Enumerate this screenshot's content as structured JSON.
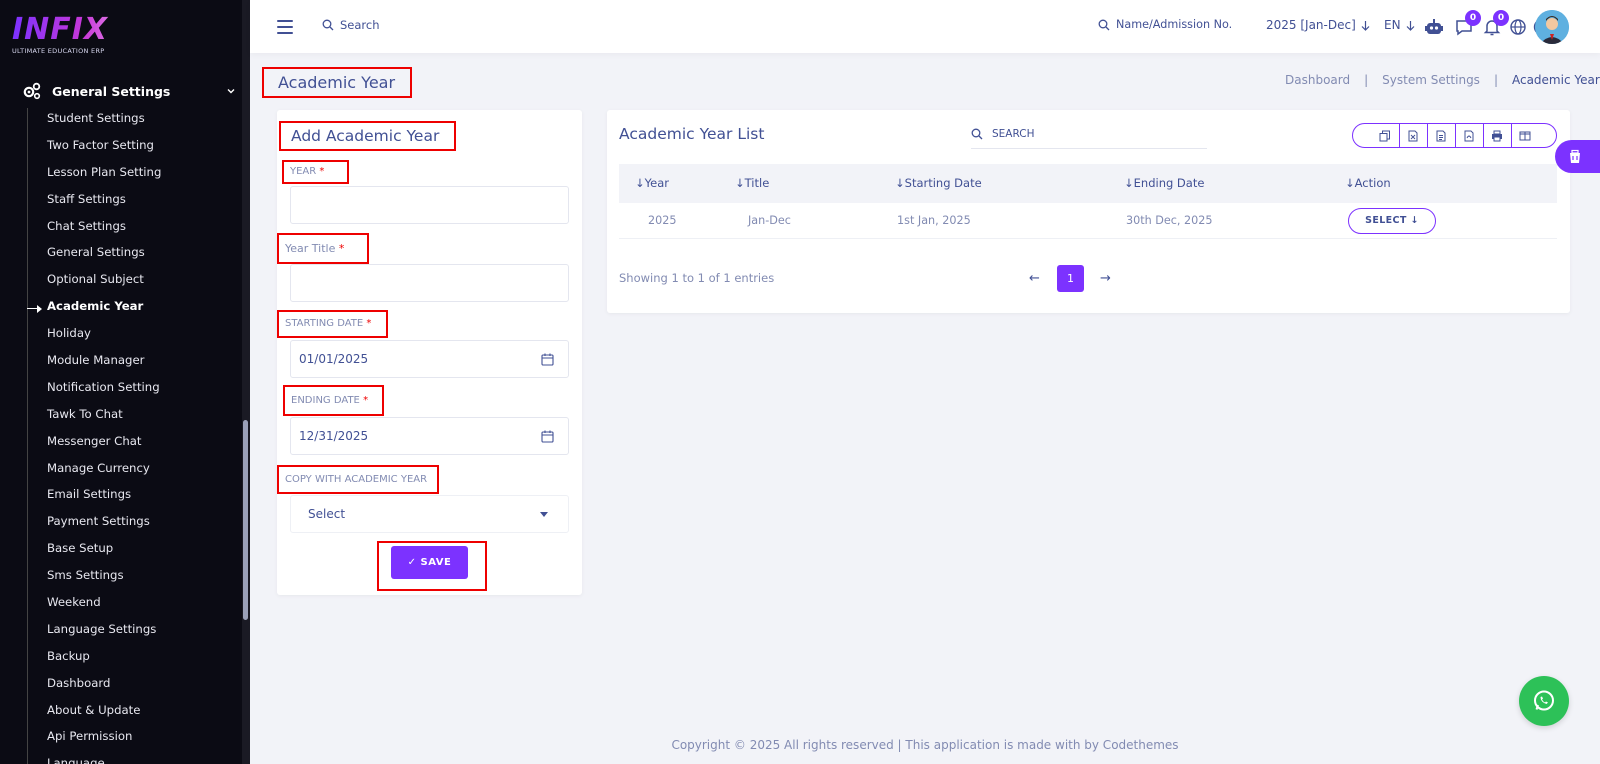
{
  "brand": {
    "logo": "INFIX",
    "tagline": "ULTIMATE EDUCATION ERP"
  },
  "sidebar": {
    "group_label": "General Settings",
    "items": [
      "Student Settings",
      "Two Factor Setting",
      "Lesson Plan Setting",
      "Staff Settings",
      "Chat Settings",
      "General Settings",
      "Optional Subject",
      "Academic Year",
      "Holiday",
      "Module Manager",
      "Notification Setting",
      "Tawk To Chat",
      "Messenger Chat",
      "Manage Currency",
      "Email Settings",
      "Payment Settings",
      "Base Setup",
      "Sms Settings",
      "Weekend",
      "Language Settings",
      "Backup",
      "Dashboard",
      "About & Update",
      "Api Permission",
      "Language"
    ],
    "active_item": "Academic Year"
  },
  "topbar": {
    "search_label": "Search",
    "admission_search": "Name/Admission No.",
    "session": "2025 [Jan-Dec]",
    "language": "EN",
    "chat_count": "0",
    "notification_count": "0"
  },
  "page": {
    "title": "Academic Year",
    "breadcrumb": [
      "Dashboard",
      "System Settings",
      "Academic Year"
    ]
  },
  "form": {
    "title": "Add Academic Year",
    "year_label": "YEAR",
    "year_value": "",
    "year_title_label": "Year Title",
    "year_title_value": "",
    "starting_date_label": "STARTING DATE",
    "starting_date_value": "01/01/2025",
    "ending_date_label": "ENDING DATE",
    "ending_date_value": "12/31/2025",
    "copy_label": "COPY WITH ACADEMIC YEAR",
    "copy_value": "Select",
    "required_mark": "*",
    "save_label": "✓ SAVE"
  },
  "list": {
    "title": "Academic Year List",
    "search_placeholder": "SEARCH",
    "columns": [
      "Year",
      "Title",
      "Starting Date",
      "Ending Date",
      "Action"
    ],
    "rows": [
      {
        "year": "2025",
        "title": "Jan-Dec",
        "start": "1st Jan, 2025",
        "end": "30th Dec, 2025",
        "action": "SELECT"
      }
    ],
    "showing": "Showing 1 to 1 of 1 entries",
    "current_page": "1"
  },
  "footer": "Copyright © 2025 All rights reserved | This application is made with by Codethemes",
  "colors": {
    "accent": "#7c32ff",
    "text": "#415094",
    "muted": "#828bb2",
    "highlight": "#e00000",
    "whatsapp": "#2dc158"
  }
}
